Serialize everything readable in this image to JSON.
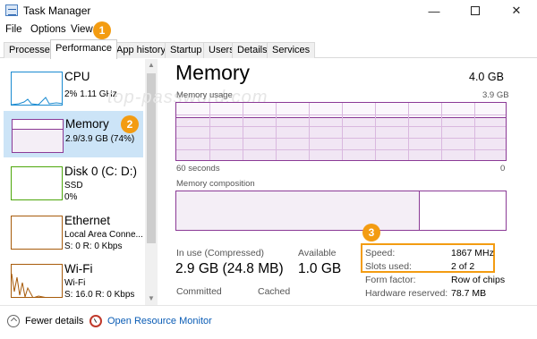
{
  "window": {
    "title": "Task Manager",
    "controls": {
      "minimize": "—",
      "close": "✕"
    }
  },
  "menu": [
    "File",
    "Options",
    "View"
  ],
  "tabs": [
    {
      "label": "Processes"
    },
    {
      "label": "Performance",
      "active": true
    },
    {
      "label": "App history"
    },
    {
      "label": "Startup"
    },
    {
      "label": "Users"
    },
    {
      "label": "Details"
    },
    {
      "label": "Services"
    }
  ],
  "sidebar": {
    "items": [
      {
        "name": "CPU",
        "line1": "2% 1.11 GHz",
        "line2": ""
      },
      {
        "name": "Memory",
        "line1": "2.9/3.9 GB (74%)",
        "line2": "",
        "active": true
      },
      {
        "name": "Disk 0 (C: D:)",
        "line1": "SSD",
        "line2": "0%"
      },
      {
        "name": "Ethernet",
        "line1": "Local Area Conne...",
        "line2": "S: 0 R: 0 Kbps"
      },
      {
        "name": "Wi-Fi",
        "line1": "Wi-Fi",
        "line2": "S: 16.0 R: 0 Kbps"
      }
    ]
  },
  "main": {
    "title": "Memory",
    "total": "4.0 GB",
    "usage_label": "Memory usage",
    "usage_max": "3.9 GB",
    "time_left": "60 seconds",
    "time_right": "0",
    "composition_label": "Memory composition",
    "stats": {
      "in_use_label": "In use (Compressed)",
      "in_use_value": "2.9 GB (24.8 MB)",
      "available_label": "Available",
      "available_value": "1.0 GB",
      "committed_label": "Committed",
      "cached_label": "Cached"
    },
    "details": [
      {
        "label": "Speed:",
        "value": "1867 MHz"
      },
      {
        "label": "Slots used:",
        "value": "2 of 2"
      },
      {
        "label": "Form factor:",
        "value": "Row of chips"
      },
      {
        "label": "Hardware reserved:",
        "value": "78.7 MB"
      }
    ]
  },
  "annotations": {
    "badge1": "1",
    "badge2": "2",
    "badge3": "3",
    "watermark": "top-password.com",
    "accent": "#f39c12"
  },
  "footer": {
    "fewer_details": "Fewer details",
    "open_monitor": "Open Resource Monitor"
  },
  "colors": {
    "memory": "#8b3a96",
    "cpu": "#1a8bd1",
    "disk": "#4da70b",
    "network": "#a75b0b",
    "selected": "#cce4f7",
    "link": "#0a5cb5"
  }
}
